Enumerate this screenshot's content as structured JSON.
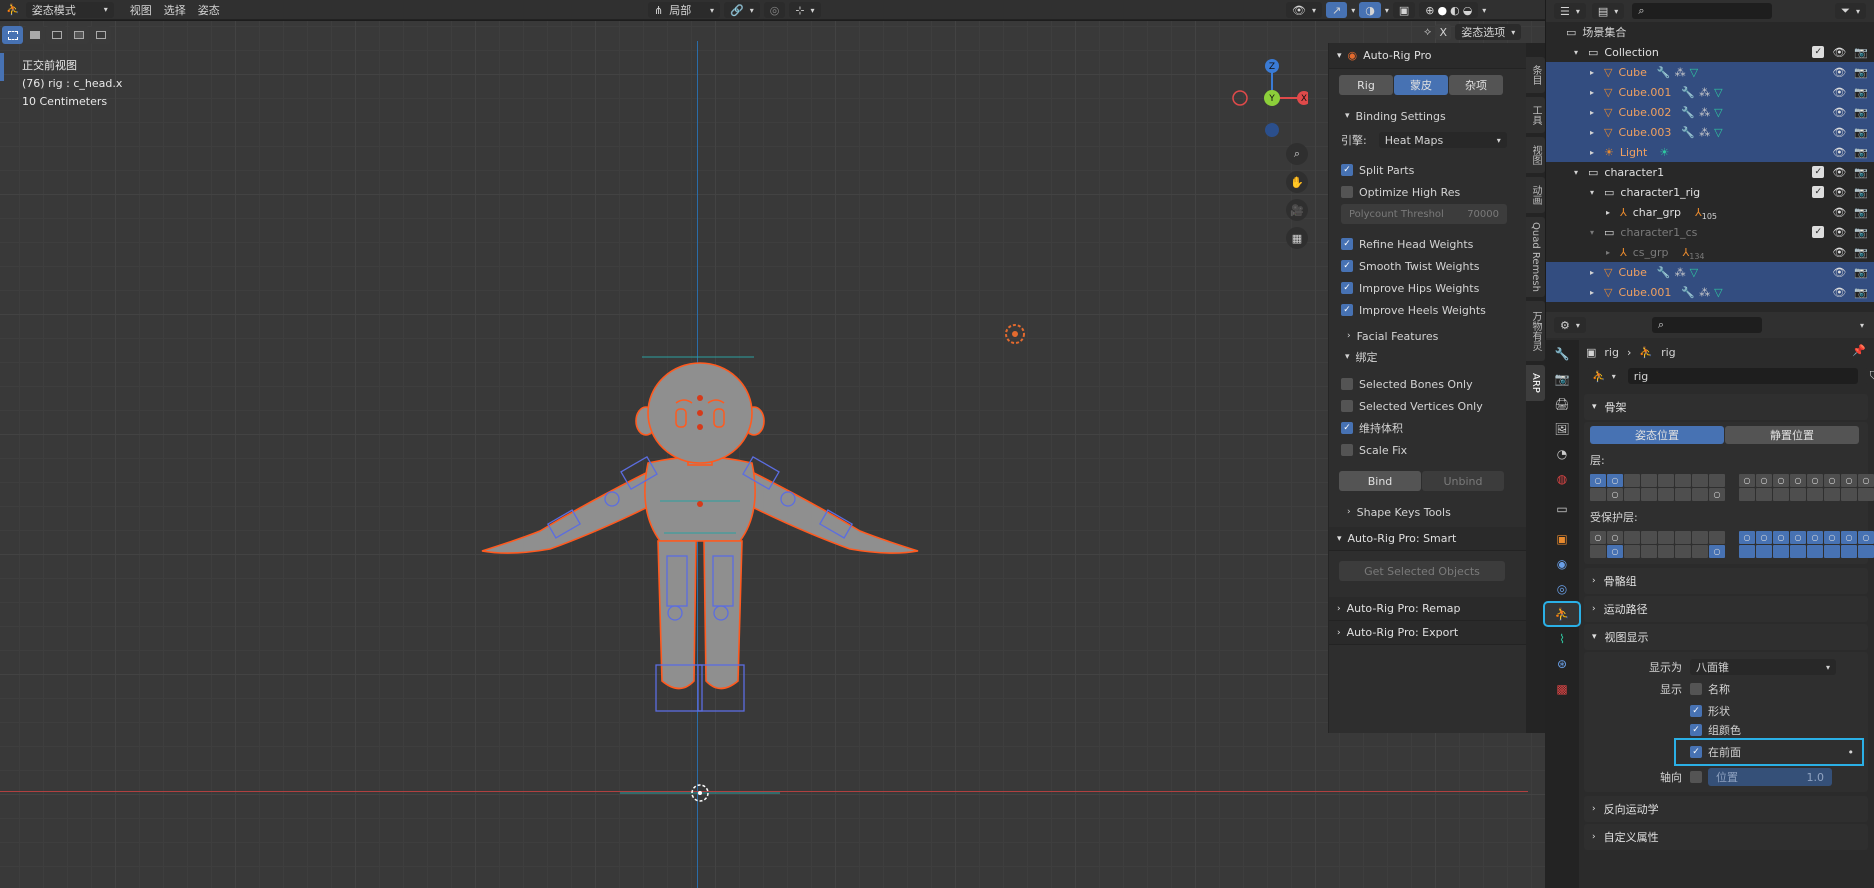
{
  "header": {
    "mode": "姿态模式",
    "menus": [
      "视图",
      "选择",
      "姿态"
    ],
    "pivot": "局部"
  },
  "viewport": {
    "view_name": "正交前视图",
    "object_info": "(76) rig : c_head.x",
    "scale": "10 Centimeters",
    "pose_options": "姿态选项",
    "x_label": "X",
    "gizmo": {
      "z": "Z",
      "y": "Y",
      "x": "X"
    }
  },
  "npanel": {
    "title": "Auto-Rig Pro",
    "tabs": [
      "Rig",
      "蒙皮",
      "杂项"
    ],
    "binding_settings": "Binding Settings",
    "engine_label": "引擎:",
    "engine_value": "Heat Maps",
    "split_parts": "Split Parts",
    "optimize_high_res": "Optimize High Res",
    "polycount_label": "Polycount Threshol",
    "polycount_value": "70000",
    "refine_head": "Refine Head Weights",
    "smooth_twist": "Smooth Twist Weights",
    "improve_hips": "Improve Hips Weights",
    "improve_heels": "Improve Heels Weights",
    "facial_features": "Facial Features",
    "bind_section": "绑定",
    "selected_bones_only": "Selected Bones Only",
    "selected_vertices_only": "Selected Vertices Only",
    "preserve_volume": "维持体积",
    "scale_fix": "Scale Fix",
    "bind": "Bind",
    "unbind": "Unbind",
    "shape_keys_tools": "Shape Keys Tools",
    "smart": "Auto-Rig Pro: Smart",
    "get_selected": "Get Selected Objects",
    "remap": "Auto-Rig Pro: Remap",
    "export": "Auto-Rig Pro: Export",
    "side_tabs": [
      "条目",
      "工具",
      "视图",
      "动画",
      "Quad Remesh",
      "万物有灵",
      "ARP"
    ]
  },
  "outliner": {
    "root": "场景集合",
    "rows": [
      {
        "name": "Collection",
        "indent": 1,
        "type": "coll",
        "sel": false
      },
      {
        "name": "Cube",
        "indent": 2,
        "type": "mesh",
        "sel": true
      },
      {
        "name": "Cube.001",
        "indent": 2,
        "type": "mesh",
        "sel": true
      },
      {
        "name": "Cube.002",
        "indent": 2,
        "type": "mesh",
        "sel": true
      },
      {
        "name": "Cube.003",
        "indent": 2,
        "type": "mesh",
        "sel": true
      },
      {
        "name": "Light",
        "indent": 2,
        "type": "light",
        "sel": true
      },
      {
        "name": "character1",
        "indent": 1,
        "type": "coll",
        "sel": false
      },
      {
        "name": "character1_rig",
        "indent": 2,
        "type": "coll",
        "sel": false
      },
      {
        "name": "char_grp",
        "indent": 3,
        "type": "empty",
        "sel": false,
        "badge": "105"
      },
      {
        "name": "character1_cs",
        "indent": 2,
        "type": "coll",
        "sel": false,
        "dim": true
      },
      {
        "name": "cs_grp",
        "indent": 3,
        "type": "empty",
        "sel": false,
        "dim": true,
        "badge": "134"
      },
      {
        "name": "Cube",
        "indent": 2,
        "type": "mesh",
        "sel": true
      },
      {
        "name": "Cube.001",
        "indent": 2,
        "type": "mesh",
        "sel": true
      }
    ]
  },
  "properties": {
    "breadcrumb_a": "rig",
    "breadcrumb_b": "rig",
    "data_name": "rig",
    "skeleton": "骨架",
    "pose_position": "姿态位置",
    "rest_position": "静置位置",
    "layers": "层:",
    "protected_layers": "受保护层:",
    "bone_groups": "骨骼组",
    "motion_paths": "运动路径",
    "viewport_display": "视图显示",
    "display_as_label": "显示为",
    "display_as_value": "八面锥",
    "show_label": "显示",
    "names": "名称",
    "shapes": "形状",
    "group_colors": "组颜色",
    "in_front": "在前面",
    "axes_label": "轴向",
    "position_label": "位置",
    "position_value": "1.0",
    "inverse_kinematics": "反向运动学",
    "custom_props": "自定义属性"
  }
}
